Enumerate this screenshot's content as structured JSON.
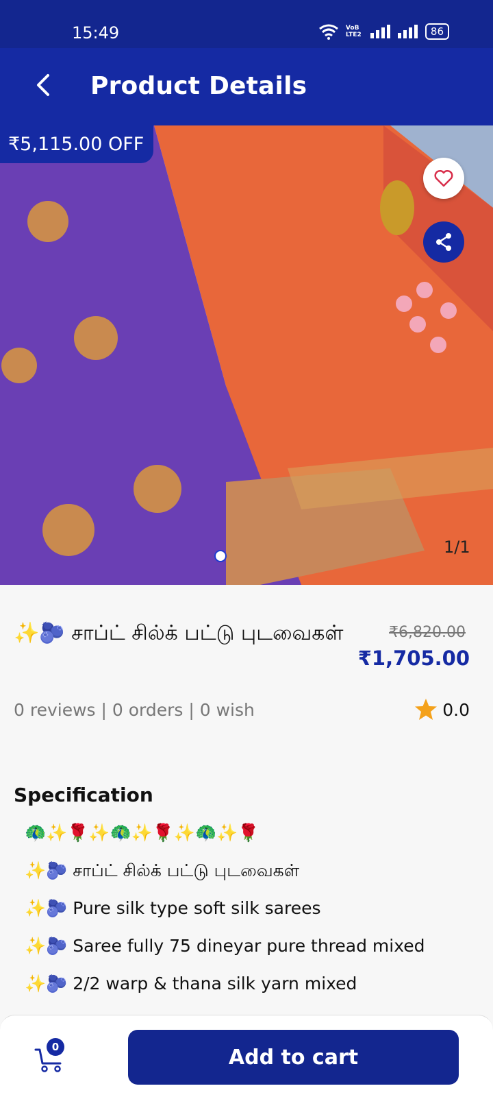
{
  "status_bar": {
    "time": "15:49",
    "network_label": "VoB LTE2",
    "battery": "86"
  },
  "header": {
    "title": "Product Details",
    "back_icon": "chevron-left-icon"
  },
  "gallery": {
    "discount_badge": "₹5,115.00 OFF",
    "page_indicator": "1/1",
    "favorite_icon": "heart-icon",
    "share_icon": "share-icon"
  },
  "product": {
    "name_prefix": "✨🫐",
    "name": "சாப்ட் சில்க் பட்டு புடவைகள்",
    "original_price": "₹6,820.00",
    "price": "₹1,705.00",
    "stats": "0 reviews | 0 orders | 0 wish",
    "rating": "0.0"
  },
  "specification": {
    "title": "Specification",
    "items": [
      "🦚✨🌹✨🦚✨🌹✨🦚✨🌹",
      "✨🫐 சாப்ட் சில்க் பட்டு புடவைகள்",
      "✨🫐 Pure silk type soft silk sarees",
      "✨🫐 Saree fully 75 dineyar pure thread mixed",
      "✨🫐 2/2 warp & thana silk yarn mixed"
    ]
  },
  "bottom_bar": {
    "cart_count": "0",
    "add_to_cart_label": "Add to cart"
  },
  "colors": {
    "brand": "#152aa3",
    "status_bar": "#13268f",
    "star": "#f4a11a"
  }
}
